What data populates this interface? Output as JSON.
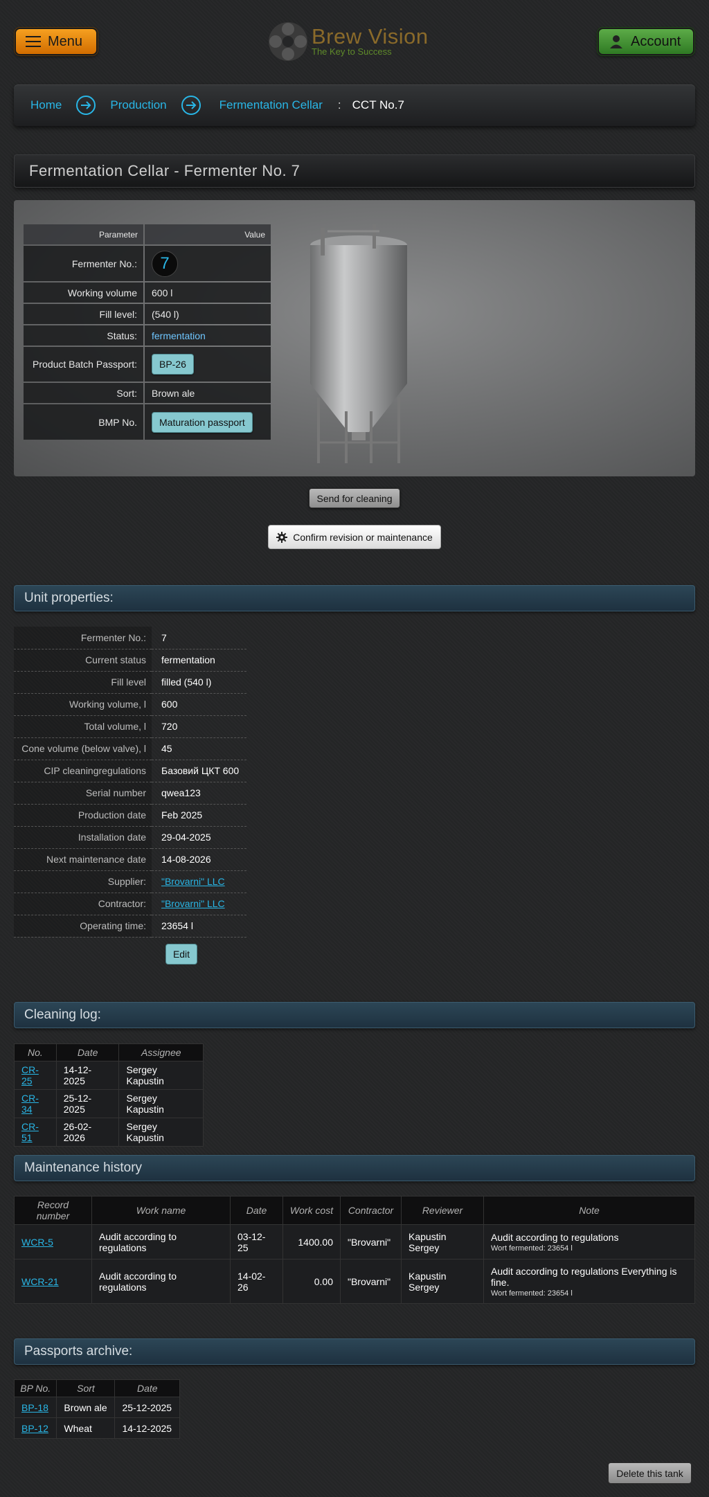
{
  "header": {
    "menu_label": "Menu",
    "logo_title": "Brew Vision",
    "logo_subtitle": "The Key to Success",
    "account_label": "Account"
  },
  "breadcrumb": {
    "items": [
      "Home",
      "Production",
      "Fermentation Cellar"
    ],
    "separator": ":",
    "current": "CCT No.7"
  },
  "page_title": "Fermentation Cellar - Fermenter No. 7",
  "params": {
    "col_parameter": "Parameter",
    "col_value": "Value",
    "rows": [
      {
        "label": "Fermenter No.:",
        "value": "7"
      },
      {
        "label": "Working volume",
        "value": "600 l"
      },
      {
        "label": "Fill level:",
        "value": "(540 l)"
      },
      {
        "label": "Status:",
        "value": "fermentation"
      },
      {
        "label": "Product Batch Passport:",
        "value": "BP-26"
      },
      {
        "label": "Sort:",
        "value": "Brown ale"
      },
      {
        "label": "BMP No.",
        "value": "Maturation passport"
      }
    ]
  },
  "actions": {
    "send_cleaning": "Send for cleaning",
    "confirm_revision": "Confirm revision or maintenance",
    "edit": "Edit",
    "delete_tank": "Delete this tank"
  },
  "unit_properties": {
    "title": "Unit properties:",
    "rows": [
      {
        "label": "Fermenter No.:",
        "value": "7"
      },
      {
        "label": "Current status",
        "value": "fermentation"
      },
      {
        "label": "Fill level",
        "value": "filled (540 l)"
      },
      {
        "label": "Working volume, l",
        "value": "600"
      },
      {
        "label": "Total volume, l",
        "value": "720"
      },
      {
        "label": "Cone volume (below valve), l",
        "value": "45"
      },
      {
        "label": "CIP cleaningregulations",
        "value": "Базовий ЦКТ 600"
      },
      {
        "label": "Serial number",
        "value": "qwea123"
      },
      {
        "label": "Production date",
        "value": "Feb 2025"
      },
      {
        "label": "Installation date",
        "value": "29-04-2025"
      },
      {
        "label": "Next maintenance date",
        "value": "14-08-2026"
      },
      {
        "label": "Supplier:",
        "value": "\"Brovarni\" LLC"
      },
      {
        "label": "Contractor:",
        "value": "\"Brovarni\" LLC"
      },
      {
        "label": "Operating time:",
        "value": "23654 l"
      }
    ]
  },
  "cleaning_log": {
    "title": "Cleaning log:",
    "columns": [
      "No.",
      "Date",
      "Assignee"
    ],
    "rows": [
      [
        "CR-25",
        "14-12-2025",
        "Sergey Kapustin"
      ],
      [
        "CR-34",
        "25-12-2025",
        "Sergey Kapustin"
      ],
      [
        "CR-51",
        "26-02-2026",
        "Sergey Kapustin"
      ]
    ]
  },
  "maintenance": {
    "title": "Maintenance history",
    "columns": [
      "Record number",
      "Work name",
      "Date",
      "Work cost",
      "Contractor",
      "Reviewer",
      "Note"
    ],
    "rows": [
      {
        "record": "WCR-5",
        "work": "Audit according to regulations",
        "date": "03-12-25",
        "cost": "1400.00",
        "contractor": "\"Brovarni\"",
        "reviewer": "Kapustin Sergey",
        "note": "Audit according to regulations",
        "note_small": "Wort fermented: 23654 l"
      },
      {
        "record": "WCR-21",
        "work": "Audit according to regulations",
        "date": "14-02-26",
        "cost": "0.00",
        "contractor": "\"Brovarni\"",
        "reviewer": "Kapustin Sergey",
        "note": "Audit according to regulations Everything is fine.",
        "note_small": "Wort fermented: 23654 l"
      }
    ]
  },
  "passports": {
    "title": "Passports archive:",
    "columns": [
      "BP No.",
      "Sort",
      "Date"
    ],
    "rows": [
      [
        "BP-18",
        "Brown ale",
        "25-12-2025"
      ],
      [
        "BP-12",
        "Wheat",
        "14-12-2025"
      ]
    ]
  }
}
